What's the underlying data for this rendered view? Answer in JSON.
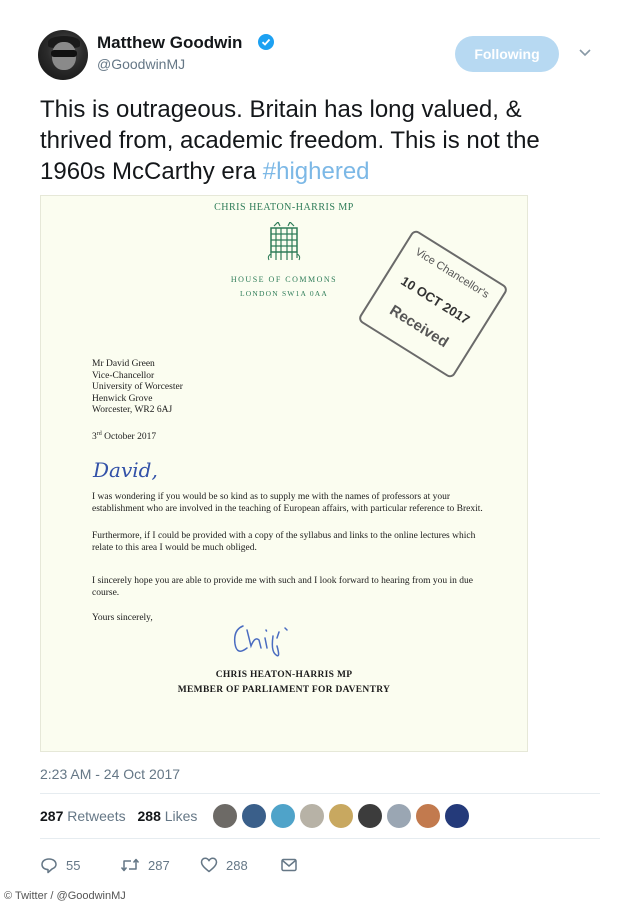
{
  "author": {
    "name": "Matthew Goodwin",
    "handle": "@GoodwinMJ",
    "verified": true
  },
  "follow_button": "Following",
  "tweet": {
    "text": "This is outrageous. Britain has long valued, & thrived from, academic freedom. This is not the 1960s McCarthy era",
    "hashtag": "#highered"
  },
  "letter": {
    "header": "CHRIS HEATON-HARRIS MP",
    "house": "HOUSE OF COMMONS",
    "address": "LONDON SW1A 0AA",
    "stamp": {
      "line1": "Vice Chancellor's",
      "line2": "10 OCT 2017",
      "line3": "Received"
    },
    "recipient": [
      "Mr David Green",
      "Vice-Chancellor",
      "University of Worcester",
      "Henwick Grove",
      "Worcester, WR2 6AJ"
    ],
    "date_day": "3",
    "date_suffix": "rd",
    "date_rest": " October 2017",
    "salutation": "David,",
    "paragraphs": [
      "I was wondering if you would be so kind as to supply me with the names of professors at your establishment who are involved in the teaching of European affairs, with particular reference to Brexit.",
      "Furthermore, if I could be provided with a copy of the syllabus and links to the online lectures which relate to this area I would be much obliged.",
      "I sincerely hope you are able to provide me with such and I look forward to hearing from you in due course."
    ],
    "closing": "Yours sincerely,",
    "signatory_name": "CHRIS HEATON-HARRIS MP",
    "signatory_title": "MEMBER OF PARLIAMENT FOR DAVENTRY"
  },
  "timestamp": "2:23 AM - 24 Oct 2017",
  "stats": {
    "retweets_count": "287",
    "retweets_label": "Retweets",
    "likes_count": "288",
    "likes_label": "Likes"
  },
  "actions": {
    "replies": "55",
    "retweets": "287",
    "likes": "288"
  },
  "credit": "© Twitter / @GoodwinMJ",
  "colors": {
    "follow_button_bg": "#b7d9f2",
    "verified": "#1da1f2",
    "hashtag": "#7cb8e6",
    "letter_green": "#2e7c58",
    "muted": "#657786"
  },
  "liker_colors": [
    "#6d6a66",
    "#3a5f8a",
    "#4fa3c9",
    "#b7b2a6",
    "#c8a860",
    "#3c3c3c",
    "#9aa6b3",
    "#c27a4e",
    "#243a7a"
  ]
}
